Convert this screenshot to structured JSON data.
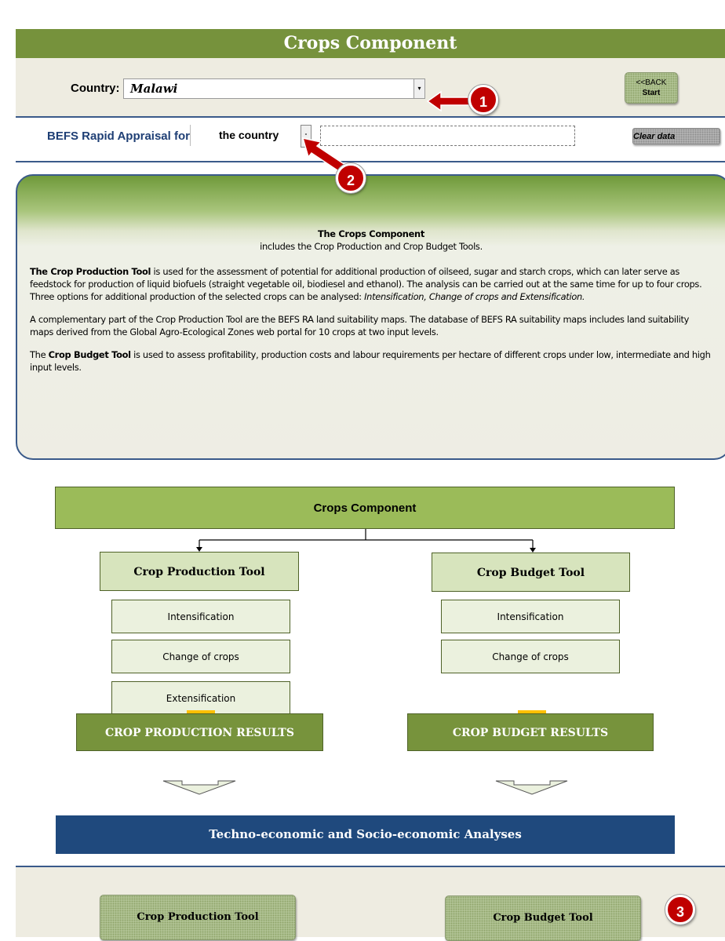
{
  "header": {
    "title": "Crops Component",
    "country_label": "Country:",
    "country_value": "Malawi",
    "back_button": {
      "line1": "<<BACK",
      "line2": "Start"
    },
    "appraisal_label": "BEFS Rapid Appraisal for",
    "area_value": "the country",
    "clear_button": "Clear data"
  },
  "info_panel": {
    "heading": "The Crops Component",
    "subheading": "includes the Crop Production and Crop Budget Tools.",
    "p1_bold": "The Crop Production Tool",
    "p1_text": " is used for the assessment of potential for additional production of oilseed, sugar and starch crops, which can later serve as feedstock for production of liquid biofuels (straight vegetable oil, biodiesel and ethanol). The analysis can be carried out at the same time for up to four crops.",
    "p1_text2": "Three options for additional production of the selected crops can be analysed: ",
    "p1_italic": "Intensification, Change of crops and Extensification.",
    "p2": "A complementary part of the Crop Production Tool are the BEFS RA land suitability maps. The database of BEFS RA suitability maps includes land suitability maps derived from the Global Agro-Ecological Zones web portal for 10 crops at two input levels.",
    "p3_prefix": "The ",
    "p3_bold": "Crop Budget Tool",
    "p3_text": " is used to assess profitability, production costs and labour requirements per hectare of different crops under low, intermediate and high input levels."
  },
  "diagram": {
    "top": "Crops Component",
    "crop_production_tool": "Crop Production Tool",
    "crop_budget_tool": "Crop Budget Tool",
    "production_options": [
      "Intensification",
      "Change of crops",
      "Extensification"
    ],
    "budget_options": [
      "Intensification",
      "Change of crops"
    ],
    "production_results": "CROP PRODUCTION RESULTS",
    "budget_results": "CROP BUDGET RESULTS",
    "analyses": "Techno-economic and Socio-economic Analyses"
  },
  "footer": {
    "crop_production_button": "Crop Production Tool",
    "crop_budget_button": "Crop Budget Tool"
  },
  "callouts": [
    "1",
    "2",
    "3"
  ],
  "colors": {
    "title_green": "#76923c",
    "band": "#eeece1",
    "navy": "#1f497d",
    "callout_red": "#c00000",
    "arrow_orange": "#ffc000"
  }
}
